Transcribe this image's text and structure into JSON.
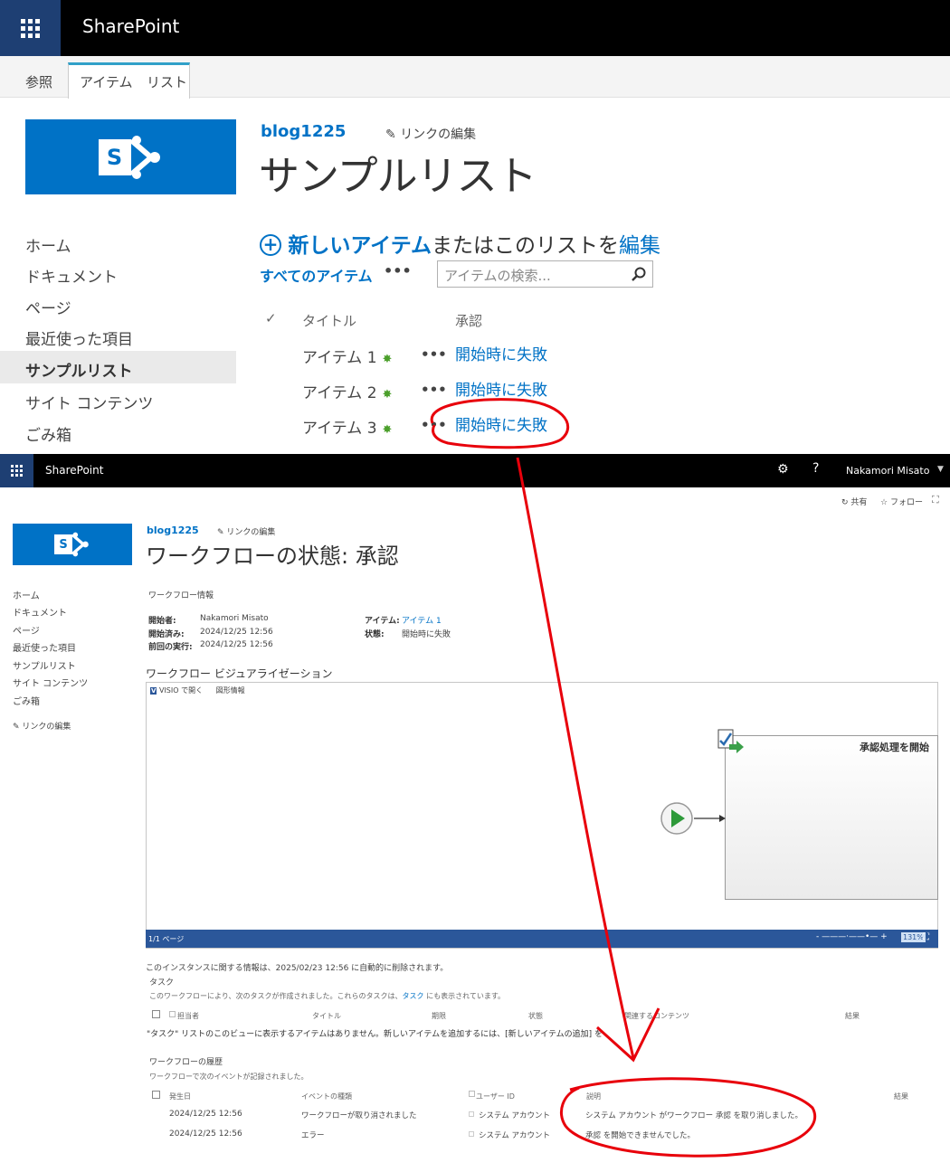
{
  "top": {
    "brand": "SharePoint",
    "ribbon_tabs": [
      "参照",
      "アイテム",
      "リスト"
    ],
    "site_name": "blog1225",
    "edit_links": "リンクの編集",
    "page_title": "サンプルリスト",
    "nav": [
      "ホーム",
      "ドキュメント",
      "ページ",
      "最近使った項目",
      "サンプルリスト",
      "サイト コンテンツ",
      "ごみ箱"
    ],
    "new_item": "新しいアイテム",
    "or_edit": "またはこのリストを",
    "edit": "編集",
    "all_items": "すべてのアイテム",
    "more": "•••",
    "search_placeholder": "アイテムの検索...",
    "columns": {
      "check": "✓",
      "title": "タイトル",
      "approval": "承認"
    },
    "rows": [
      {
        "title": "アイテム 1",
        "status": "開始時に失敗"
      },
      {
        "title": "アイテム 2",
        "status": "開始時に失敗"
      },
      {
        "title": "アイテム 3",
        "status": "開始時に失敗"
      }
    ]
  },
  "bottom": {
    "brand": "SharePoint",
    "user": "Nakamori Misato",
    "share": "共有",
    "follow": "フォロー",
    "site_name": "blog1225",
    "edit_links": "リンクの編集",
    "page_title": "ワークフローの状態: 承認",
    "nav": [
      "ホーム",
      "ドキュメント",
      "ページ",
      "最近使った項目",
      "サンプルリスト",
      "サイト コンテンツ",
      "ごみ箱"
    ],
    "nav_edit": "リンクの編集",
    "info_heading": "ワークフロー情報",
    "initiator_label": "開始者:",
    "initiator": "Nakamori Misato",
    "started_label": "開始済み:",
    "started": "2024/12/25 12:56",
    "last_run_label": "前回の実行:",
    "last_run": "2024/12/25 12:56",
    "item_label": "アイテム:",
    "item": "アイテム 1",
    "status_label": "状態:",
    "status": "開始時に失敗",
    "visual_heading": "ワークフロー ビジュアライゼーション",
    "visio_open": "VISIO で開く",
    "shape_info": "図形情報",
    "visio_shape_text": "承認処理を開始",
    "visio_page": "1/1 ページ",
    "zoom": "131%",
    "retention_note": "このインスタンスに関する情報は、2025/02/23 12:56 に自動的に削除されます。",
    "tasks_heading": "タスク",
    "tasks_note_pre": "このワークフローにより、次のタスクが作成されました。これらのタスクは、",
    "tasks_note_link": "タスク",
    "tasks_note_post": " にも表示されています。",
    "task_columns": [
      "担当者",
      "タイトル",
      "期限",
      "状態",
      "関連するコンテンツ",
      "結果"
    ],
    "tasks_empty": "\"タスク\" リストのこのビューに表示するアイテムはありません。新しいアイテムを追加するには、[新しいアイテムの追加] をクリックしてください。",
    "history_heading": "ワークフローの履歴",
    "history_note": "ワークフローで次のイベントが記録されました。",
    "history_columns": [
      "発生日",
      "イベントの種類",
      "ユーザー ID",
      "説明",
      "結果"
    ],
    "history_rows": [
      {
        "date": "2024/12/25 12:56",
        "event": "ワークフローが取り消されました",
        "user": "システム アカウント",
        "desc": "システム アカウント がワークフロー 承認 を取り消しました。"
      },
      {
        "date": "2024/12/25 12:56",
        "event": "エラー",
        "user": "システム アカウント",
        "desc": "承認 を開始できませんでした。"
      }
    ]
  },
  "colors": {
    "accent": "#0072c6",
    "suite_bar": "#000000",
    "waffle": "#1e3f73",
    "annotation": "#e8000b",
    "status_bar": "#2b579a"
  }
}
